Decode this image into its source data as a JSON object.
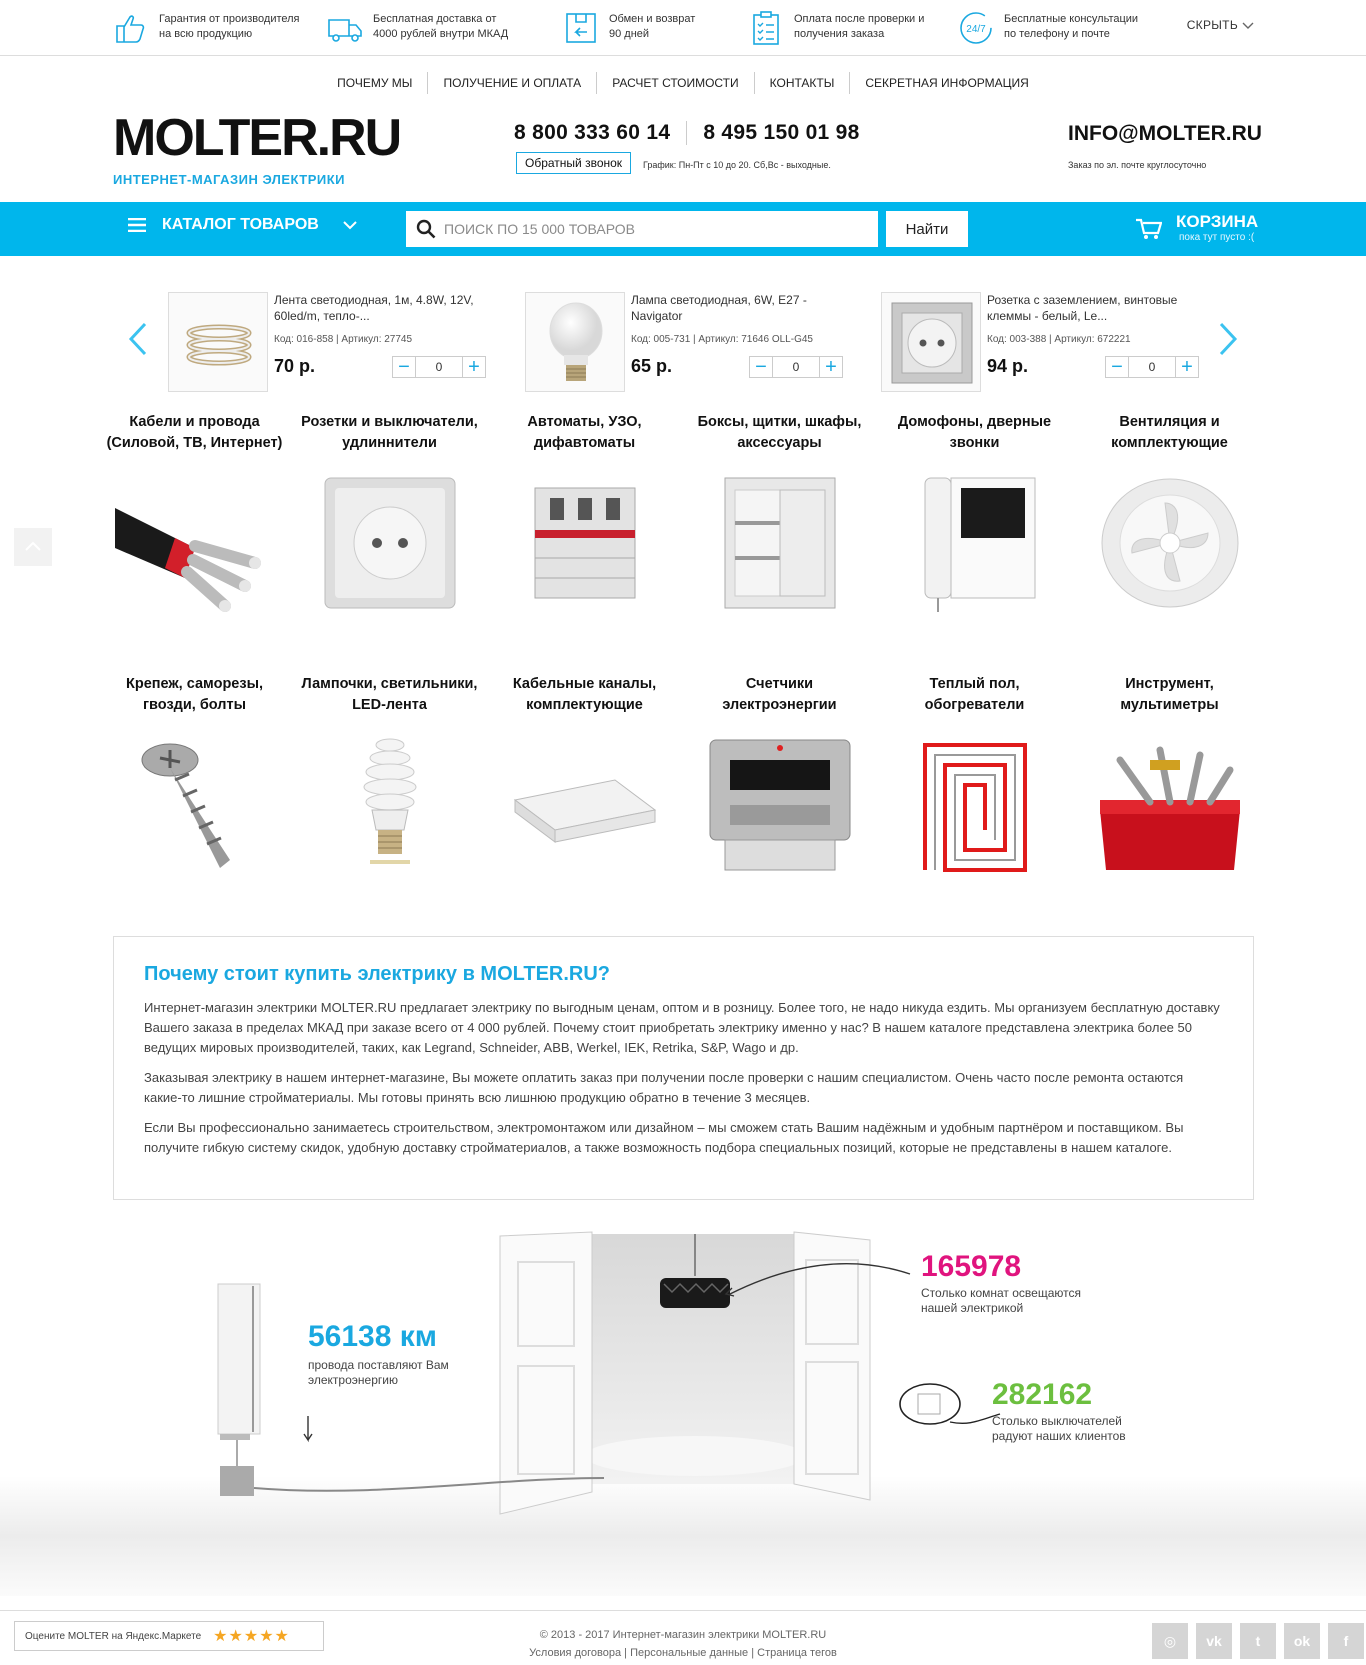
{
  "benefits": [
    {
      "icon": "thumbs-up-icon",
      "line1": "Гарантия от производителя",
      "line2": "на всю продукцию"
    },
    {
      "icon": "delivery-truck-icon",
      "line1": "Бесплатная доставка от",
      "line2": "4000 рублей внутри МКАД"
    },
    {
      "icon": "return-box-icon",
      "line1": "Обмен и возврат",
      "line2": "90 дней"
    },
    {
      "icon": "checklist-icon",
      "line1": "Оплата после проверки и",
      "line2": "получения заказа"
    },
    {
      "icon": "support-24-7-icon",
      "line1": "Бесплатные консультации",
      "line2": "по телефону и почте"
    }
  ],
  "hide_label": "СКРЫТЬ",
  "nav": [
    "ПОЧЕМУ МЫ",
    "ПОЛУЧЕНИЕ И ОПЛАТА",
    "РАСЧЕТ СТОИМОСТИ",
    "КОНТАКТЫ",
    "СЕКРЕТНАЯ ИНФОРМАЦИЯ"
  ],
  "header": {
    "logo": "MOLTER.RU",
    "logo_sub": "ИНТЕРНЕТ-МАГАЗИН ЭЛЕКТРИКИ",
    "phone1": "8 800 333 60 14",
    "phone2": "8 495 150 01 98",
    "callback": "Обратный звонок",
    "schedule": "График: Пн-Пт с 10 до 20. Сб,Вс - выходные.",
    "email": "INFO@MOLTER.RU",
    "email_sub": "Заказ по эл. почте круглосуточно"
  },
  "bar": {
    "catalog": "КАТАЛОГ ТОВАРОВ",
    "search_placeholder": "ПОИСК ПО 15 000 ТОВАРОВ",
    "find": "Найти",
    "cart_title": "КОРЗИНА",
    "cart_sub": "пока тут пусто :("
  },
  "products": [
    {
      "name": "Лента светодиодная, 1м, 4.8W, 12V, 60led/m, тепло-...",
      "code": "Код: 016-858 | Артикул: 27745",
      "price": "70 р.",
      "qty": "0"
    },
    {
      "name": "Лампа светодиодная, 6W, E27 - Navigator",
      "code": "Код: 005-731 | Артикул: 71646 OLL-G45",
      "price": "65 р.",
      "qty": "0"
    },
    {
      "name": "Розетка с заземлением, винтовые клеммы - белый, Le...",
      "code": "Код: 003-388 | Артикул: 672221",
      "price": "94 р.",
      "qty": "0"
    }
  ],
  "categories": [
    {
      "l1": "Кабели и провода",
      "l2": "(Силовой, ТВ, Интернет)"
    },
    {
      "l1": "Розетки и выключатели,",
      "l2": "удлиннители"
    },
    {
      "l1": "Автоматы, УЗО,",
      "l2": "дифавтоматы"
    },
    {
      "l1": "Боксы, щитки, шкафы,",
      "l2": "аксессуары"
    },
    {
      "l1": "Домофоны, дверные",
      "l2": "звонки"
    },
    {
      "l1": "Вентиляция и",
      "l2": "комплектующие"
    },
    {
      "l1": "Крепеж, саморезы,",
      "l2": "гвозди, болты"
    },
    {
      "l1": "Лампочки, светильники,",
      "l2": "LED-лента"
    },
    {
      "l1": "Кабельные каналы,",
      "l2": "комплектующие"
    },
    {
      "l1": "Счетчики",
      "l2": "электроэнергии"
    },
    {
      "l1": "Теплый пол,",
      "l2": "обогреватели"
    },
    {
      "l1": "Инструмент,",
      "l2": "мультиметры"
    }
  ],
  "why": {
    "title": "Почему стоит купить электрику в MOLTER.RU?",
    "p1": "Интернет-магазин электрики MOLTER.RU предлагает электрику по выгодным ценам, оптом и в розницу. Более того, не надо никуда ездить. Мы организуем бесплатную доставку Вашего заказа в пределах МКАД при заказе всего от 4 000 рублей. Почему стоит приобретать электрику именно у нас? В нашем каталоге представлена электрика более 50 ведущих мировых производителей, таких, как Legrand, Schneider, ABB, Werkel, IEK, Retrika, S&P, Wago и др.",
    "p2": "Заказывая электрику в нашем интернет-магазине, Вы можете оплатить заказ при получении после проверки с нашим специалистом. Очень часто после ремонта остаются какие-то лишние стройматериалы. Мы готовы принять всю лишнюю продукцию обратно в течение 3 месяцев.",
    "p3": "Если Вы профессионально занимаетесь строительством, электромонтажом или дизайном – мы сможем стать Вашим надёжным и удобным партнёром и поставщиком. Вы получите гибкую систему скидок, удобную доставку стройматериалов, а также возможность подбора специальных позиций, которые не представлены в нашем каталоге."
  },
  "stats": {
    "cable_num": "56138 км",
    "cable_l1": "провода поставляют Вам",
    "cable_l2": "электроэнергию",
    "rooms_num": "165978",
    "rooms_l1": "Столько комнат освещаются",
    "rooms_l2": "нашей электрикой",
    "switch_num": "282162",
    "switch_l1": "Столько выключателей",
    "switch_l2": "радуют наших клиентов",
    "colors": {
      "cable": "#1aa8e0",
      "rooms": "#e0147e",
      "switch": "#6cbf3f"
    }
  },
  "footer": {
    "ymarket": "Оцените MOLTER на Яндекс.Маркете",
    "stars": "★★★★★",
    "copyright": "© 2013 - 2017 Интернет-магазин электрики MOLTER.RU",
    "link1": "Условия договора",
    "link2": "Персональные данные",
    "link3": "Страница тегов",
    "social": [
      "instagram-icon",
      "vk-icon",
      "twitter-icon",
      "odnoklassniki-icon",
      "facebook-icon"
    ]
  }
}
